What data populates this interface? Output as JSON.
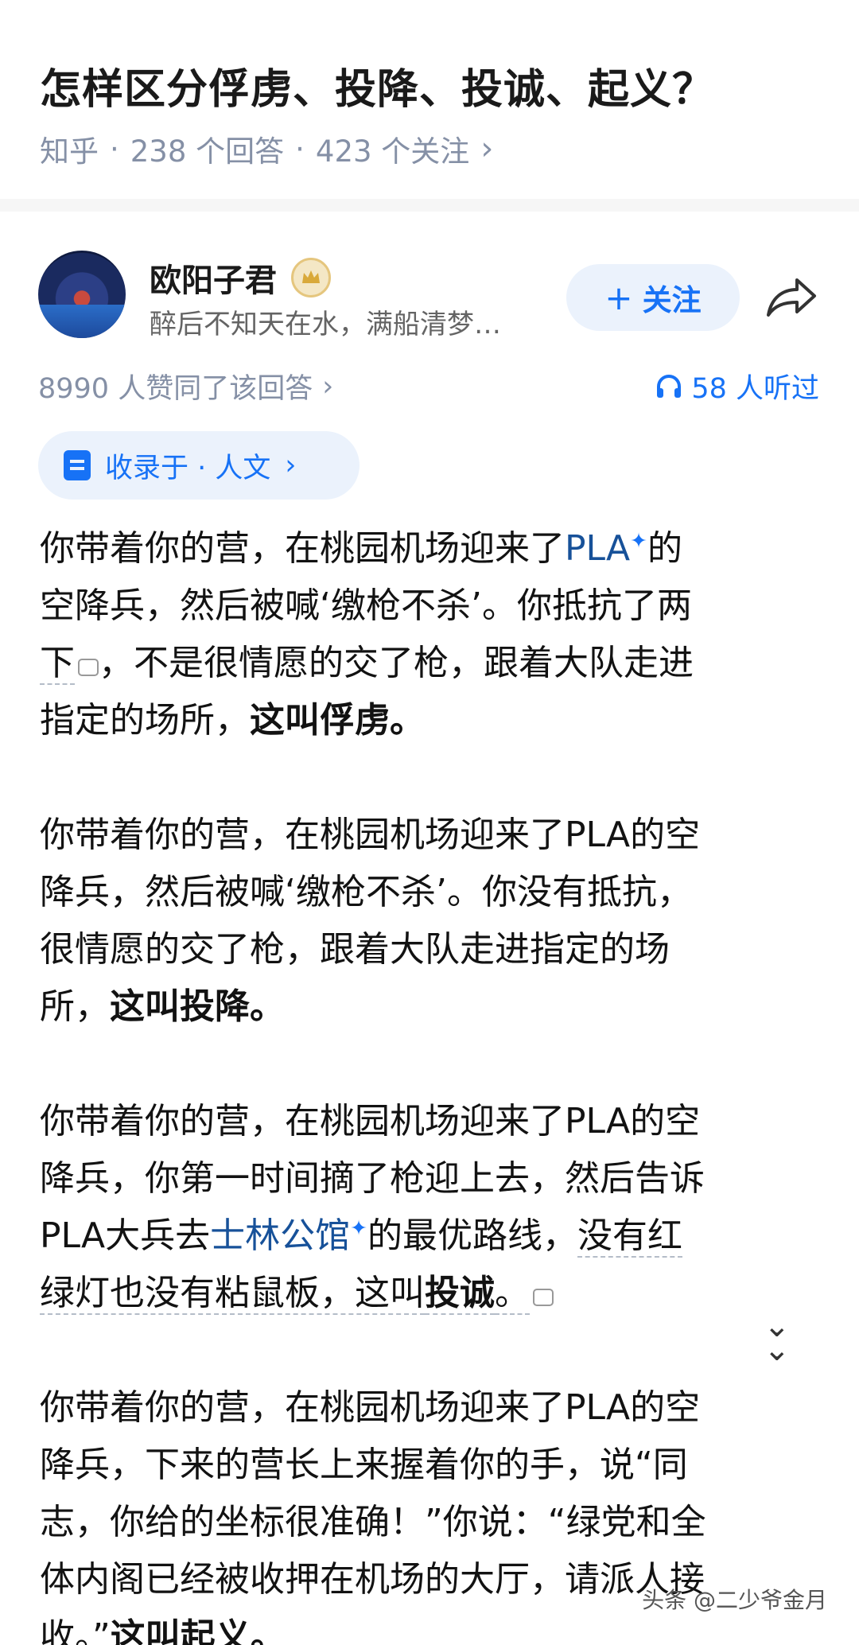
{
  "question": {
    "title": "怎样区分俘虏、投降、投诚、起义？",
    "source": "知乎",
    "answers": "238 个回答",
    "followers": "423 个关注"
  },
  "author": {
    "name": "欧阳子君",
    "bio": "醉后不知天在水，满船清梦…",
    "follow_label": "关注"
  },
  "stats": {
    "likes": "8990 人赞同了该回答",
    "listens": "58 人听过"
  },
  "collection": {
    "label": "收录于 · 人文"
  },
  "content": {
    "p1": {
      "l1a": "你带着你的营，在桃园机场迎来了",
      "l1link": "PLA",
      "l1b": "的",
      "l2": "空降兵，然后被喊‘缴枪不杀’。你抵抗了两",
      "l3a": "下",
      "l3b": "，不是很情愿的交了枪，跟着大队走进",
      "l4a": "指定的场所，",
      "l4b": "这叫俘虏。"
    },
    "p2": {
      "l1": "你带着你的营，在桃园机场迎来了PLA的空",
      "l2": "降兵，然后被喊‘缴枪不杀’。你没有抵抗，",
      "l3": "很情愿的交了枪，跟着大队走进指定的场",
      "l4a": "所，",
      "l4b": "这叫投降。"
    },
    "p3": {
      "l1": "你带着你的营，在桃园机场迎来了PLA的空",
      "l2": "降兵，你第一时间摘了枪迎上去，然后告诉",
      "l3a": "PLA大兵去",
      "l3link": "士林公馆",
      "l3b": "的最优路线，",
      "l3c": "没有红",
      "l4a": "绿灯也没有粘鼠板，这叫",
      "l4b": "投诚",
      "l4c": "。"
    },
    "p4": {
      "l1": "你带着你的营，在桃园机场迎来了PLA的空",
      "l2": "降兵，下来的营长上来握着你的手，说“同",
      "l3": "志，你给的坐标很准确！”你说：“绿党和全",
      "l4": "体内阁已经被收押在机场的大厅，请派人接",
      "l5a": "收。”",
      "l5b": "这叫起义。"
    }
  },
  "watermark": "头条 @二少爷金月",
  "colors": {
    "accent": "#1772f6",
    "link": "#175199",
    "meta": "#8590a6"
  }
}
